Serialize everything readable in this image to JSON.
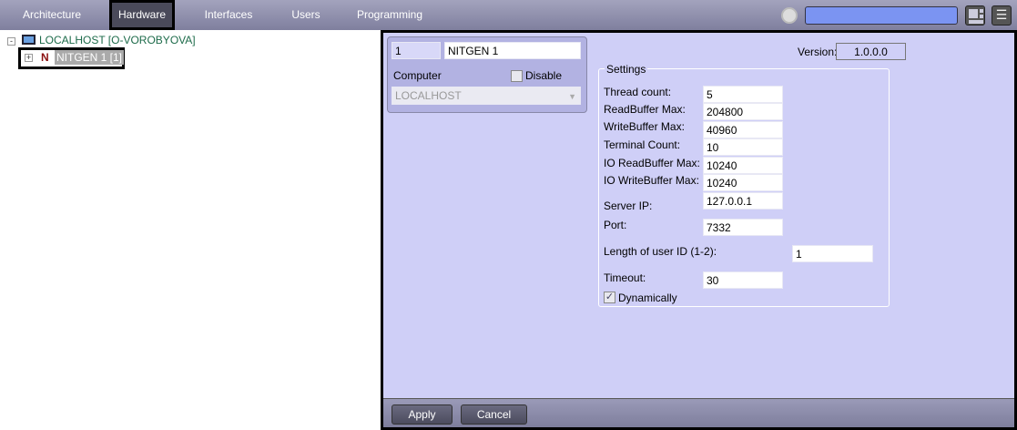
{
  "tabs": [
    "Architecture",
    "Hardware",
    "Interfaces",
    "Users",
    "Programming"
  ],
  "tree": {
    "root": "LOCALHOST [O-VOROBYOVA]",
    "child": "NITGEN 1 [1]",
    "child_icon_letter": "N"
  },
  "device": {
    "id": "1",
    "name": "NITGEN 1",
    "computer_label": "Computer",
    "disable_label": "Disable",
    "computer_value": "LOCALHOST"
  },
  "version": {
    "label": "Version:",
    "value": "1.0.0.0"
  },
  "settings": {
    "title": "Settings",
    "thread_label": "Thread count:",
    "thread": "5",
    "readbuf_label": "ReadBuffer Max:",
    "readbuf": "204800",
    "writebuf_label": "WriteBuffer Max:",
    "writebuf": "40960",
    "terminal_label": "Terminal Count:",
    "terminal": "10",
    "ioread_label": "IO ReadBuffer Max:",
    "ioread": "10240",
    "iowrite_label": "IO WriteBuffer Max:",
    "iowrite": "10240",
    "ip_label": "Server IP:",
    "ip": "127.0.0.1",
    "port_label": "Port:",
    "port": "7332",
    "uidlen_label": "Length of user ID (1-2):",
    "uidlen": "1",
    "timeout_label": "Timeout:",
    "timeout": "30",
    "dynamic_label": "Dynamically"
  },
  "buttons": {
    "apply": "Apply",
    "cancel": "Cancel"
  }
}
